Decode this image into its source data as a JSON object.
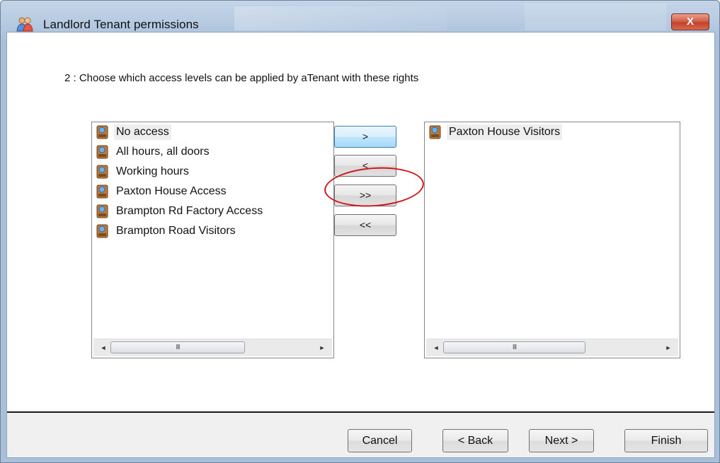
{
  "window": {
    "title": "Landlord Tenant permissions",
    "close_label": "X"
  },
  "instruction": "2 : Choose which access levels can be applied by aTenant with these rights",
  "available_list": {
    "items": [
      {
        "label": "No access",
        "selected": true
      },
      {
        "label": "All hours, all doors"
      },
      {
        "label": "Working hours"
      },
      {
        "label": "Paxton House Access"
      },
      {
        "label": "Brampton Rd Factory Access"
      },
      {
        "label": "Brampton Road Visitors"
      }
    ],
    "scroll_left": "◄",
    "scroll_thumb": "III",
    "scroll_right": "►"
  },
  "selected_list": {
    "items": [
      {
        "label": "Paxton House Visitors",
        "selected": true
      }
    ],
    "scroll_left": "◄",
    "scroll_thumb": "III",
    "scroll_right": "►"
  },
  "move_buttons": {
    "add": ">",
    "remove": "<",
    "add_all": ">>",
    "remove_all": "<<"
  },
  "footer": {
    "cancel": "Cancel",
    "back": "< Back",
    "next": "Next >",
    "finish": "Finish"
  },
  "colors": {
    "highlight_ellipse": "#d01818",
    "close_button": "#c2432b"
  },
  "icons": {
    "title": "users-icon",
    "list_item": "access-level-icon"
  }
}
